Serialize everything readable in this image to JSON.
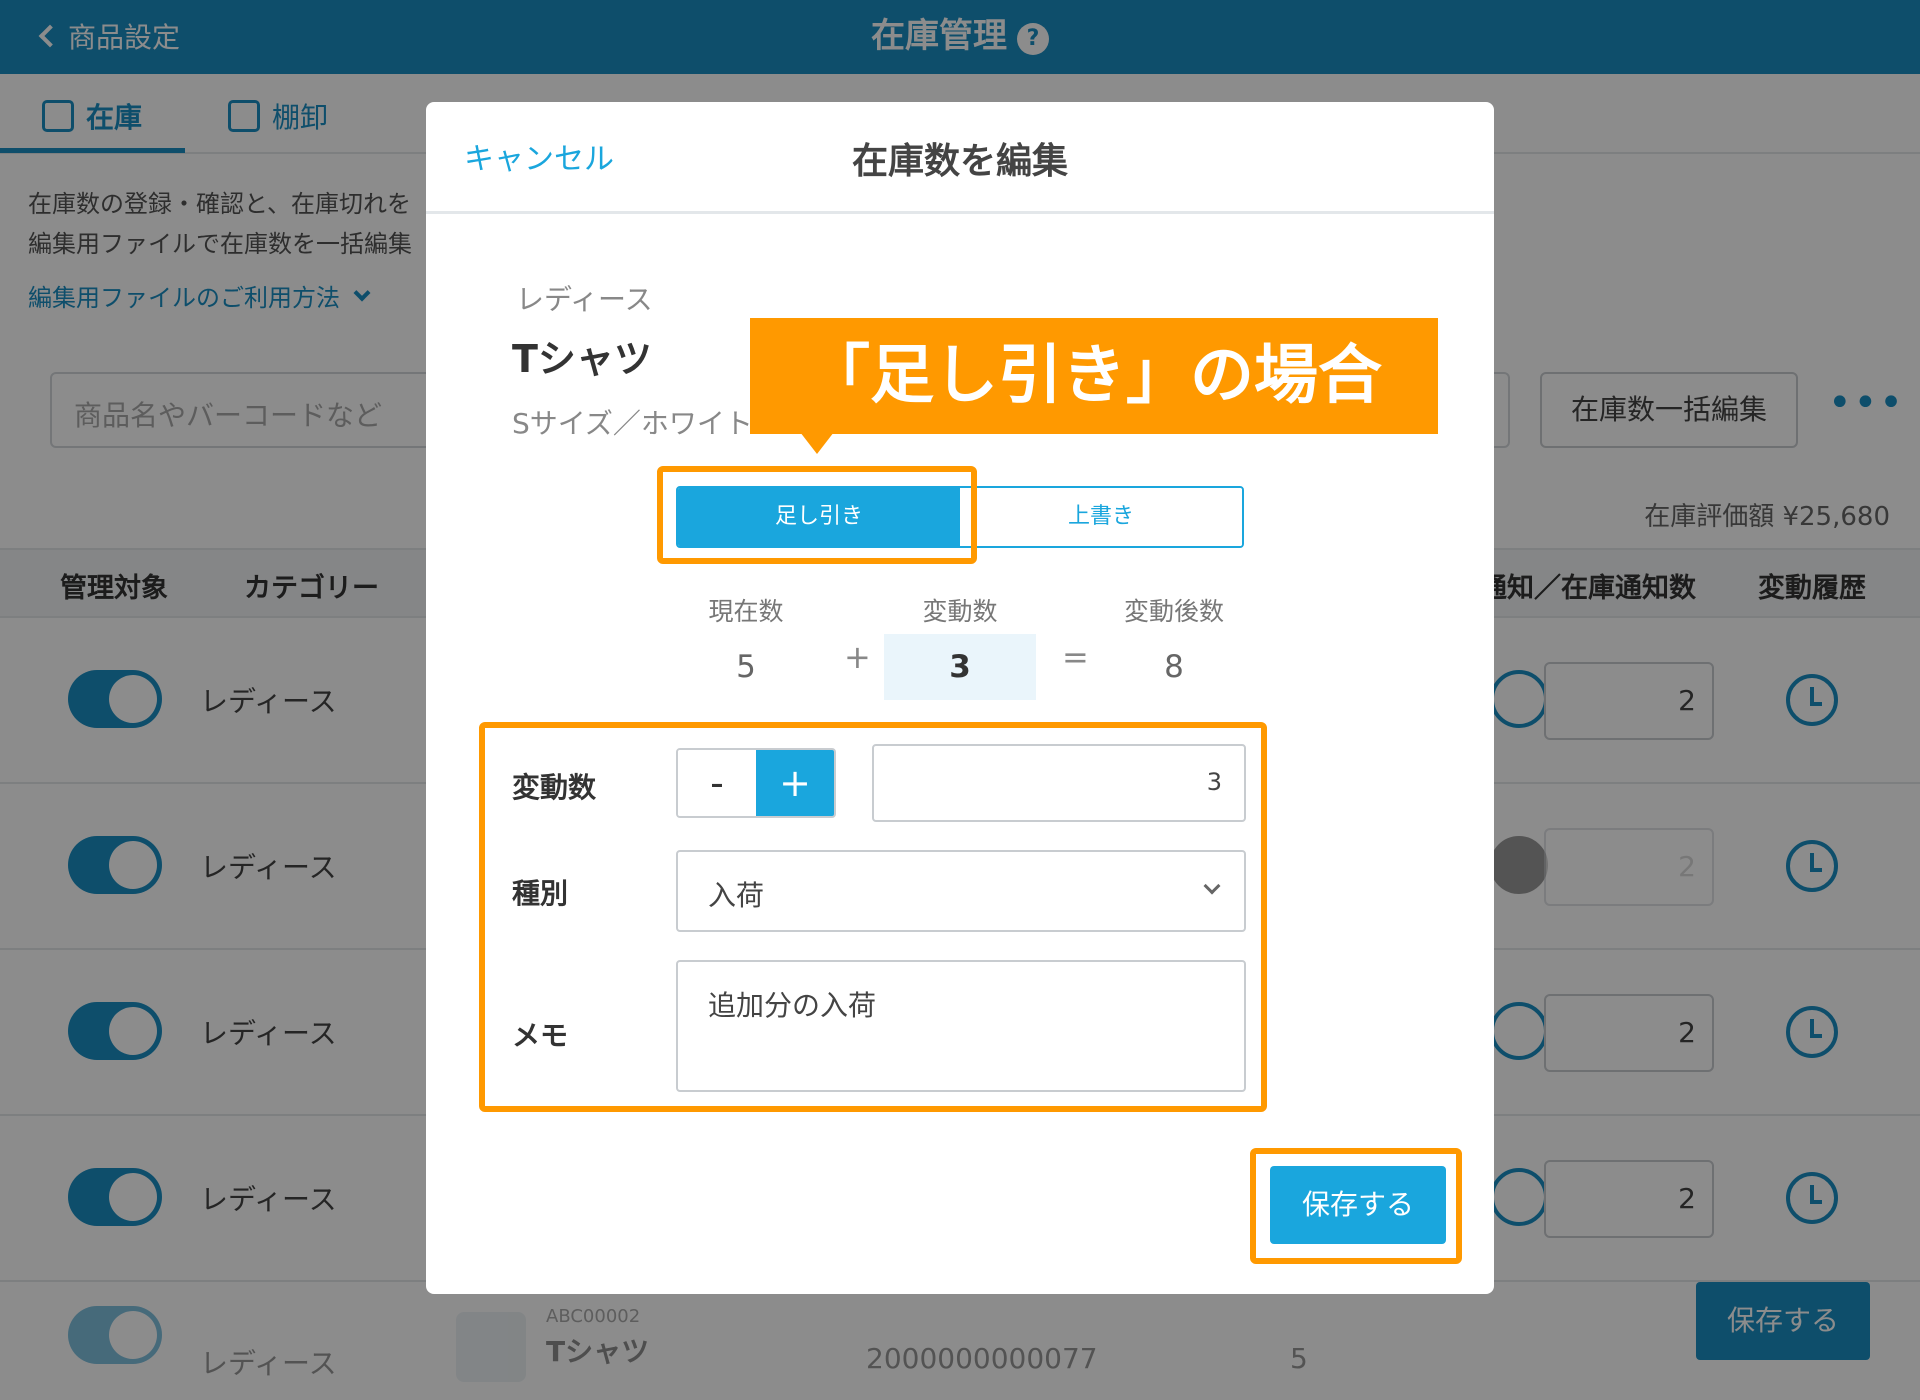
{
  "header": {
    "back_label": "商品設定",
    "title": "在庫管理",
    "help": "?"
  },
  "tabs": [
    {
      "label": "在庫"
    },
    {
      "label": "棚卸"
    }
  ],
  "description": {
    "line1": "在庫数の登録・確認と、在庫切れを",
    "line2": "編集用ファイルで在庫数を一括編集",
    "link": "編集用ファイルのご利用方法"
  },
  "toolbar": {
    "search_placeholder": "商品名やバーコードなど",
    "bulk_edit": "在庫数一括編集",
    "more": "•••"
  },
  "valuation": "在庫評価額 ¥25,680",
  "table": {
    "headers": {
      "managed": "管理対象",
      "category": "カテゴリー",
      "notify": "通知／在庫通知数",
      "history": "変動履歴"
    },
    "rows": [
      {
        "category": "レディース",
        "notify_count": "2"
      },
      {
        "category": "レディース",
        "notify_count": "2"
      },
      {
        "category": "レディース",
        "notify_count": "2"
      },
      {
        "category": "レディース",
        "notify_count": "2"
      }
    ],
    "row5": {
      "category": "レディース",
      "code": "ABC00002",
      "name": "Tシャツ",
      "barcode": "2000000000077",
      "stock": "5"
    }
  },
  "page_save": "保存する",
  "modal": {
    "cancel": "キャンセル",
    "title": "在庫数を編集",
    "product": {
      "category": "レディース",
      "name": "Tシャツ",
      "variant": "Sサイズ／ホワイト"
    },
    "mode": {
      "options": [
        "足し引き",
        "上書き"
      ],
      "selected": "足し引き"
    },
    "calc": {
      "current_label": "現在数",
      "current": "5",
      "plus": "+",
      "change_label": "変動数",
      "change": "3",
      "equals": "=",
      "after_label": "変動後数",
      "after": "8"
    },
    "form": {
      "change_label": "変動数",
      "minus": "-",
      "plus": "+",
      "quantity": "3",
      "type_label": "種別",
      "type_value": "入荷",
      "memo_label": "メモ",
      "memo_value": "追加分の入荷"
    },
    "save": "保存する"
  },
  "annotation": {
    "callout": "「足し引き」の場合"
  },
  "colors": {
    "primary": "#1aa6dd",
    "header": "#1a8fc4",
    "highlight": "#ff9900"
  }
}
